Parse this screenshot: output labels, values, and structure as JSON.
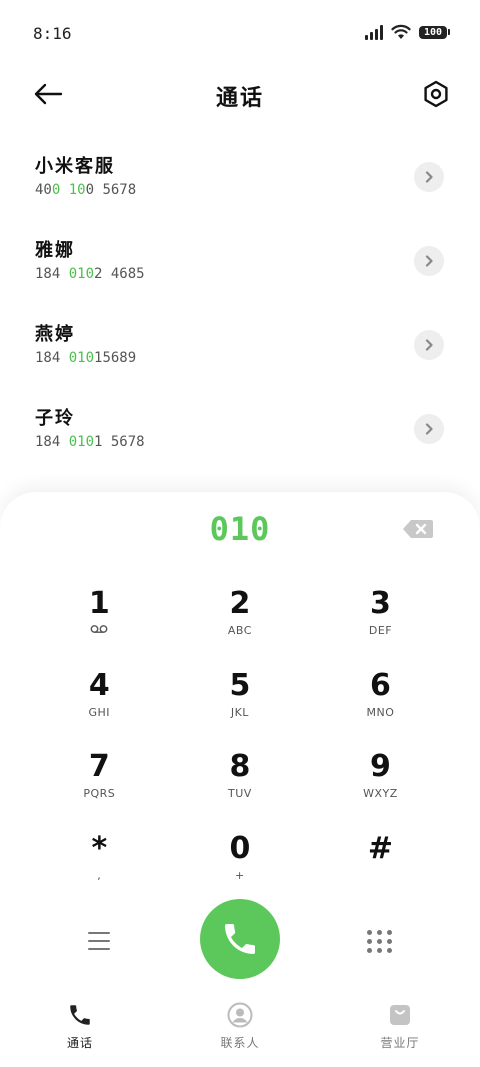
{
  "status_bar": {
    "time": "8:16",
    "battery": "100"
  },
  "header": {
    "title": "通话"
  },
  "contacts": [
    {
      "name": "小米客服",
      "number_parts": [
        "40",
        "0",
        " ",
        "10",
        "0 5678"
      ]
    },
    {
      "name": "雅娜",
      "number_parts": [
        "184 ",
        "010",
        "2 4685",
        "",
        ""
      ]
    },
    {
      "name": "燕婷",
      "number_parts": [
        "184 ",
        "010",
        "15689",
        "",
        ""
      ]
    },
    {
      "name": "子玲",
      "number_parts": [
        "184 ",
        "010",
        "1 5678",
        "",
        ""
      ]
    }
  ],
  "dialer": {
    "display": "010",
    "keys": [
      {
        "digit": "1",
        "letters": ""
      },
      {
        "digit": "2",
        "letters": "ABC"
      },
      {
        "digit": "3",
        "letters": "DEF"
      },
      {
        "digit": "4",
        "letters": "GHI"
      },
      {
        "digit": "5",
        "letters": "JKL"
      },
      {
        "digit": "6",
        "letters": "MNO"
      },
      {
        "digit": "7",
        "letters": "PQRS"
      },
      {
        "digit": "8",
        "letters": "TUV"
      },
      {
        "digit": "9",
        "letters": "WXYZ"
      },
      {
        "digit": "*",
        "letters": ","
      },
      {
        "digit": "0",
        "letters": "+"
      },
      {
        "digit": "#",
        "letters": ""
      }
    ]
  },
  "bottom_nav": {
    "tabs": [
      {
        "label": "通话",
        "icon": "phone-icon",
        "active": true
      },
      {
        "label": "联系人",
        "icon": "contact-icon",
        "active": false
      },
      {
        "label": "营业厅",
        "icon": "shopping-bag-icon",
        "active": false
      }
    ]
  },
  "colors": {
    "accent": "#5cc85c",
    "highlight": "#4cbf4c"
  }
}
